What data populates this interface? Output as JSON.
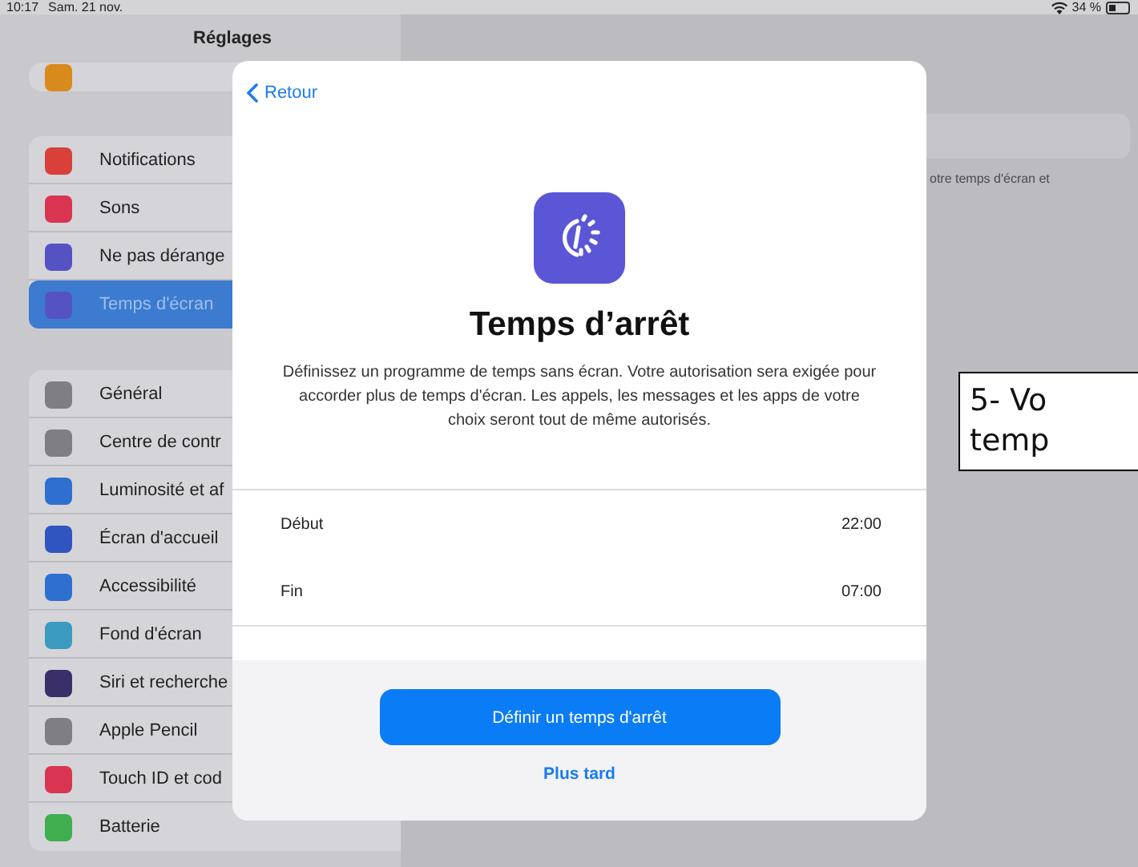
{
  "status_bar": {
    "time": "10:17",
    "date": "Sam. 21 nov.",
    "battery": "34 %"
  },
  "sidebar": {
    "title": "Réglages",
    "groups": [
      {
        "items": [
          {
            "selected": false,
            "color": "#d98a1c"
          }
        ]
      },
      {
        "items": [
          {
            "label": "Notifications",
            "selected": false,
            "color": "#d9403a"
          },
          {
            "label": "Sons",
            "selected": false,
            "color": "#d93552"
          },
          {
            "label": "Ne pas dérange",
            "selected": false,
            "color": "#5552c4"
          },
          {
            "label": "Temps d'écran",
            "selected": true,
            "color": "#5552c4"
          }
        ]
      },
      {
        "items": [
          {
            "label": "Général",
            "selected": false,
            "color": "#7f7f83"
          },
          {
            "label": "Centre de contr",
            "selected": false,
            "color": "#7f7f83"
          },
          {
            "label": "Luminosité et af",
            "selected": false,
            "color": "#2f6fd0"
          },
          {
            "label": "Écran d'accueil",
            "selected": false,
            "color": "#2f56c0"
          },
          {
            "label": "Accessibilité",
            "selected": false,
            "color": "#2f6fd0"
          },
          {
            "label": "Fond d'écran",
            "selected": false,
            "color": "#3a9ac0"
          },
          {
            "label": "Siri et recherche",
            "selected": false,
            "color": "#3b2f6a"
          },
          {
            "label": "Apple Pencil",
            "selected": false,
            "color": "#7f7f83"
          },
          {
            "label": "Touch ID et cod",
            "selected": false,
            "color": "#d93552"
          },
          {
            "label": "Batterie",
            "selected": false,
            "color": "#3fae4f"
          }
        ]
      }
    ]
  },
  "detail": {
    "caption": "otre temps d'écran et"
  },
  "modal": {
    "back": "Retour",
    "title": "Temps d’arrêt",
    "description": "Définissez un programme de temps sans écran. Votre autorisation sera exigée pour accorder plus de temps d'écran. Les appels, les messages et les apps de votre choix seront tout de même autorisés.",
    "rows": [
      {
        "label": "Début",
        "value": "22:00"
      },
      {
        "label": "Fin",
        "value": "07:00"
      }
    ],
    "primary_button": "Définir un temps d'arrêt",
    "secondary_button": "Plus tard"
  },
  "annotation": {
    "lines": [
      "5- Vo",
      "temp"
    ]
  }
}
